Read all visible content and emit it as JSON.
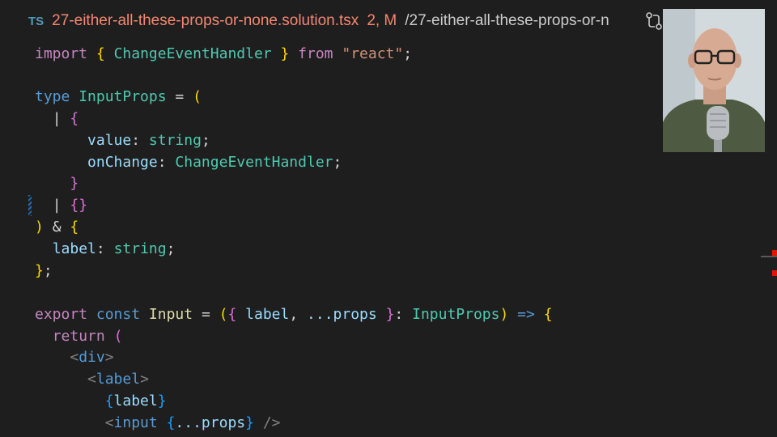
{
  "tab": {
    "lang_icon": "TS",
    "file_name": "27-either-all-these-props-or-none.solution.tsx",
    "badge": "2, M",
    "path": "/27-either-all-these-props-or-n",
    "diff_icon": "git-compare-icon"
  },
  "code": {
    "l1": [
      "import",
      "{",
      "ChangeEventHandler",
      "}",
      "from",
      "\"react\"",
      ";"
    ],
    "l3": [
      "type",
      "InputProps",
      "=",
      "("
    ],
    "l4": [
      "|",
      "{"
    ],
    "l5": [
      "value",
      ":",
      "string",
      ";"
    ],
    "l6": [
      "onChange",
      ":",
      "ChangeEventHandler",
      ";"
    ],
    "l7": [
      "}"
    ],
    "l8": [
      "|",
      "{}"
    ],
    "l9": [
      ")",
      "&",
      "{"
    ],
    "l10": [
      "label",
      ":",
      "string",
      ";"
    ],
    "l11": [
      "}",
      ";"
    ],
    "l13": [
      "export",
      "const",
      "Input",
      "=",
      "(",
      "{",
      "label",
      ",",
      "...props",
      "}",
      ":",
      "InputProps",
      ")",
      "=>",
      "{"
    ],
    "l14": [
      "return",
      "("
    ],
    "l15": [
      "<",
      "div",
      ">"
    ],
    "l16": [
      "<",
      "label",
      ">"
    ],
    "l17": [
      "{",
      "label",
      "}"
    ],
    "l18": [
      "<",
      "input",
      "{",
      "...props",
      "}",
      "/>"
    ]
  },
  "colors": {
    "background": "#1e1e1e",
    "error_marker": "#e51400",
    "file_modified": "#f48771"
  }
}
